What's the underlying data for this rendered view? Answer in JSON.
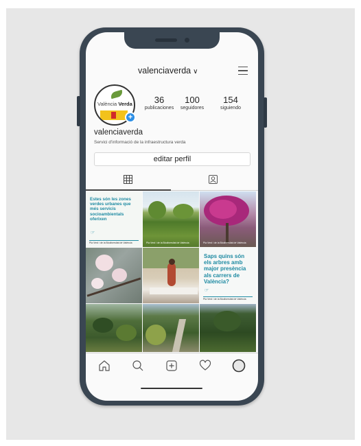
{
  "profile": {
    "username": "valenciaverda",
    "display_name": "valenciaverda",
    "bio": "Servici d'informació de la infraestructura verda",
    "logo_text_light": "València",
    "logo_text_bold": "Verda",
    "add_story_symbol": "+"
  },
  "stats": [
    {
      "value": "36",
      "label": "publicaciones"
    },
    {
      "value": "100",
      "label": "seguidores"
    },
    {
      "value": "154",
      "label": "siguiendo"
    }
  ],
  "buttons": {
    "edit_profile": "editar perfil"
  },
  "posts": [
    {
      "type": "text",
      "text": "Estes són les zones verdes urbanes que més servicis socioambientals oferixen",
      "footer": "Pla Verd i de la Biodiversitat de València"
    },
    {
      "type": "photo",
      "subject": "park lawn with trees",
      "footer": "Pla Verd i de la Biodiversitat de València"
    },
    {
      "type": "photo",
      "subject": "pink bougainvillea tree",
      "footer": "Pla Verd i de la Biodiversitat de València"
    },
    {
      "type": "photo",
      "subject": "almond blossoms"
    },
    {
      "type": "photo",
      "subject": "woman sitting on bench"
    },
    {
      "type": "text",
      "text": "Saps quins són els arbres amb major presència als carrers de València?",
      "footer": "Pla Verd i de la Biodiversitat de València"
    },
    {
      "type": "photo",
      "subject": "garden shrubs"
    },
    {
      "type": "photo",
      "subject": "park path"
    },
    {
      "type": "photo",
      "subject": "trees"
    }
  ],
  "icons": {
    "header": [
      "chevron-down-icon",
      "hamburger-menu-icon"
    ],
    "tabs": [
      "grid-icon",
      "tagged-person-icon"
    ],
    "nav": [
      "home-icon",
      "search-icon",
      "add-post-icon",
      "heart-icon",
      "profile-avatar-icon"
    ]
  },
  "colors": {
    "phone_frame": "#3a4652",
    "accent_teal": "#1e8aa2",
    "add_badge": "#2d8fe6",
    "logo_green": "#6a9a3b"
  }
}
